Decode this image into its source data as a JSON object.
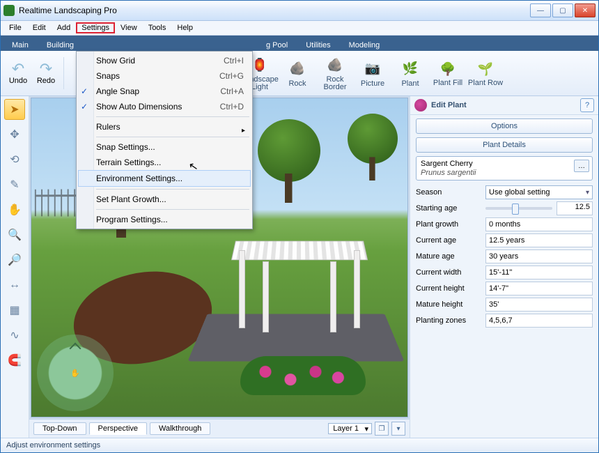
{
  "title": "Realtime Landscaping Pro",
  "menubar": [
    "File",
    "Edit",
    "Add",
    "Settings",
    "View",
    "Tools",
    "Help"
  ],
  "menubar_active_index": 3,
  "tabs": [
    "Main",
    "Building",
    "g Pool",
    "Utilities",
    "Modeling"
  ],
  "undo": "Undo",
  "redo": "Redo",
  "ribbon": [
    {
      "label": "Landscape Light",
      "icon": "🏮"
    },
    {
      "label": "Rock",
      "icon": "🪨"
    },
    {
      "label": "Rock Border",
      "icon": "🪨"
    },
    {
      "label": "Picture",
      "icon": "📷"
    },
    {
      "label": "Plant",
      "icon": "🌿"
    },
    {
      "label": "Plant Fill",
      "icon": "🌳"
    },
    {
      "label": "Plant Row",
      "icon": "🌱"
    }
  ],
  "settings_menu": [
    {
      "label": "Show Grid",
      "shortcut": "Ctrl+I"
    },
    {
      "label": "Snaps",
      "shortcut": "Ctrl+G"
    },
    {
      "label": "Angle Snap",
      "shortcut": "Ctrl+A",
      "checked": true
    },
    {
      "label": "Show Auto Dimensions",
      "shortcut": "Ctrl+D",
      "checked": true
    },
    {
      "sep": true
    },
    {
      "label": "Rulers",
      "submenu": true
    },
    {
      "sep": true
    },
    {
      "label": "Snap Settings..."
    },
    {
      "label": "Terrain Settings..."
    },
    {
      "label": "Environment Settings...",
      "highlight": true
    },
    {
      "sep": true
    },
    {
      "label": "Set Plant Growth..."
    },
    {
      "sep": true
    },
    {
      "label": "Program Settings..."
    }
  ],
  "view_tabs": [
    "Top-Down",
    "Perspective",
    "Walkthrough"
  ],
  "view_tab_active": 1,
  "layer": "Layer 1",
  "right": {
    "title": "Edit Plant",
    "options_btn": "Options",
    "details_btn": "Plant Details",
    "plant_name": "Sargent Cherry",
    "plant_latin": "Prunus sargentii",
    "rows": {
      "season_label": "Season",
      "season_value": "Use global setting",
      "startage_label": "Starting age",
      "startage_value": "12.5",
      "growth_label": "Plant growth",
      "growth_value": "0 months",
      "curage_label": "Current age",
      "curage_value": "12.5 years",
      "matage_label": "Mature age",
      "matage_value": "30 years",
      "curw_label": "Current width",
      "curw_value": "15'-11\"",
      "curh_label": "Current height",
      "curh_value": "14'-7\"",
      "math_label": "Mature height",
      "math_value": "35'",
      "zones_label": "Planting zones",
      "zones_value": "4,5,6,7"
    }
  },
  "status": "Adjust environment settings"
}
